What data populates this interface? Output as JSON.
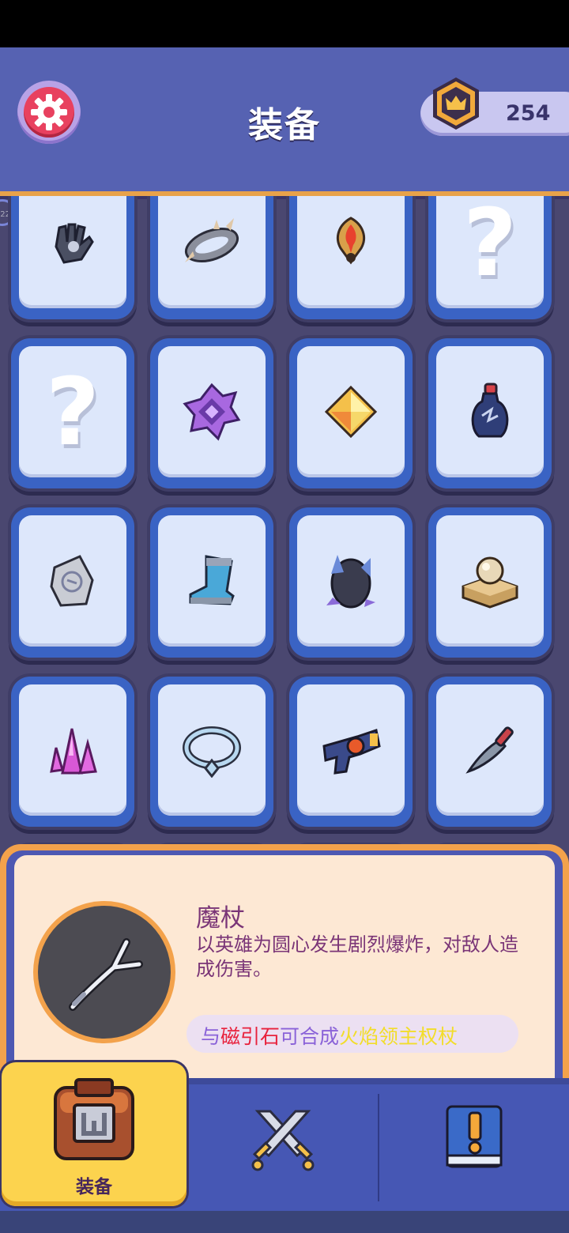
{
  "header": {
    "title": "装备",
    "coins": "254"
  },
  "edge_badge": "22",
  "grid": {
    "rows": [
      [
        "gauntlet",
        "spiked-bracelet",
        "fire-amulet",
        "unknown"
      ],
      [
        "unknown",
        "purple-crystal",
        "yellow-gem",
        "potion-bottle"
      ],
      [
        "stone-tablet",
        "boot",
        "rock-crystal",
        "pearl-pedestal"
      ],
      [
        "pink-crystal",
        "silver-necklace",
        "blaster",
        "knife"
      ]
    ],
    "unknown_glyph": "?"
  },
  "detail": {
    "name": "魔杖",
    "description": "以英雄为圆心发生剧烈爆炸，对敌人造成伤害。",
    "combo": {
      "prefix": "与",
      "material": "磁引石",
      "middle": "可合成",
      "result": "火焰领主权杖"
    },
    "colors": {
      "text": "#7a3577",
      "material": "#e8213c",
      "middle": "#8a62d8",
      "result": "#f2dd2a"
    }
  },
  "nav": {
    "tabs": [
      {
        "id": "equipment",
        "label": "装备",
        "icon": "chest-icon",
        "active": true
      },
      {
        "id": "battle",
        "icon": "crossed-swords-icon"
      },
      {
        "id": "quests",
        "icon": "quest-book-icon"
      }
    ]
  }
}
